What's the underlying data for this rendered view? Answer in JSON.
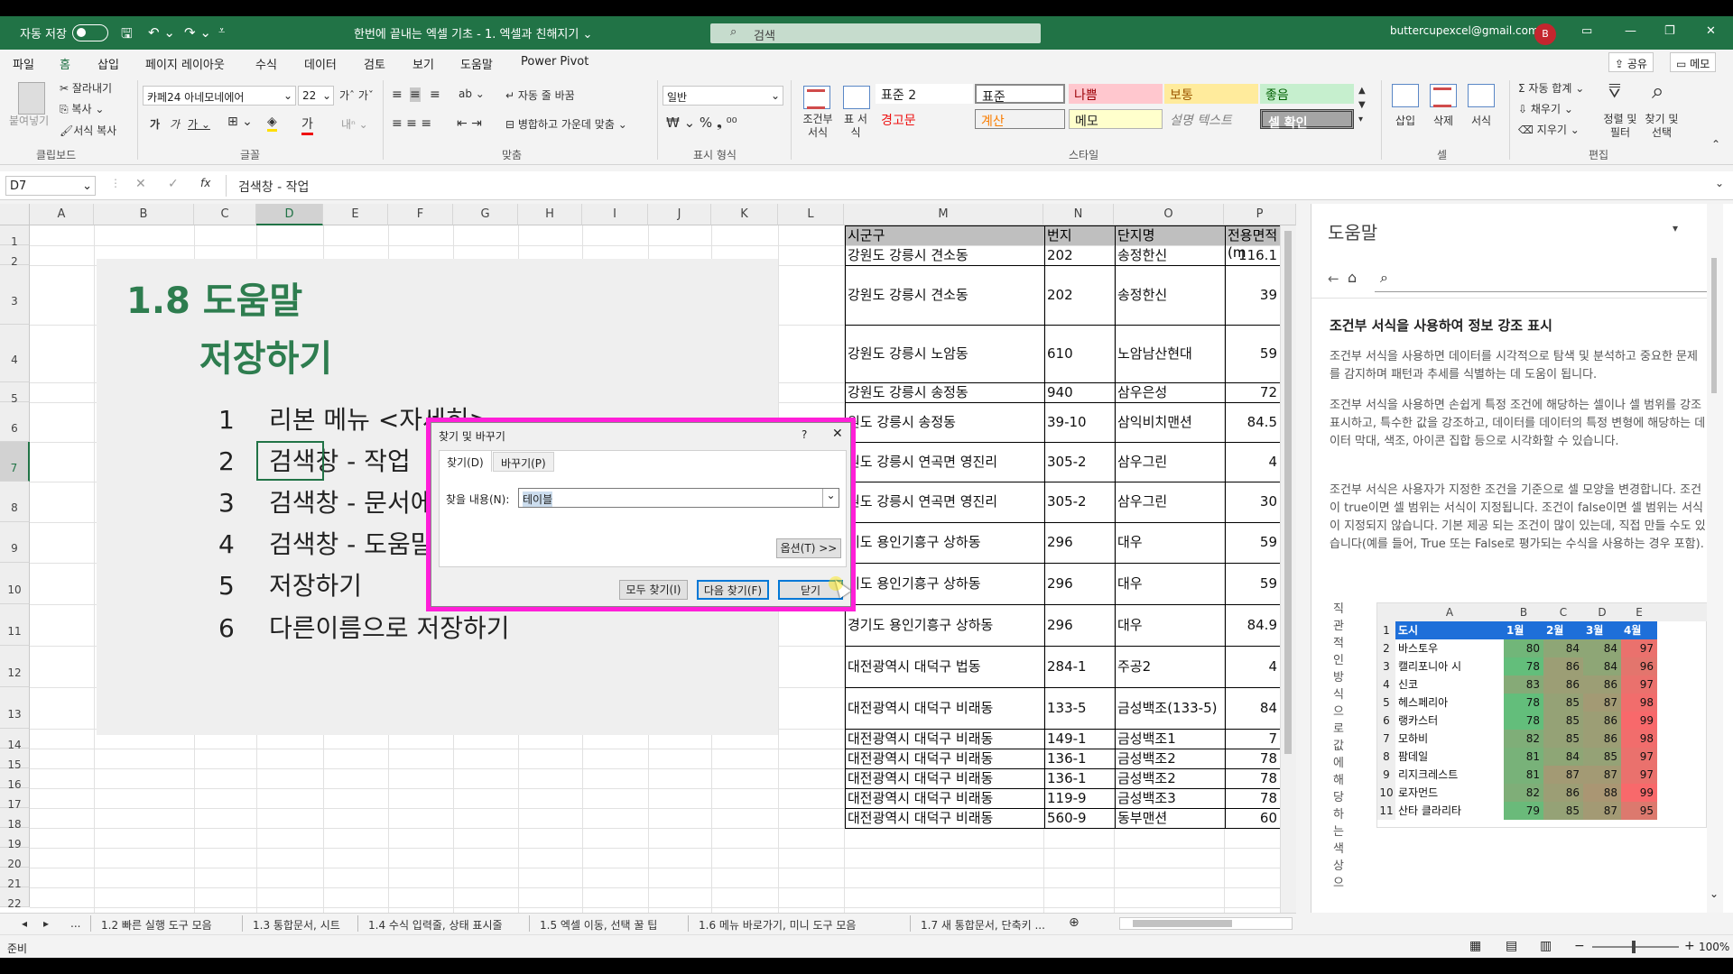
{
  "titlebar": {
    "autosave": "자동 저장",
    "doc_title": "한번에 끝내는 엑셀 기초 - 1. 엑셀과 친해지기 ⌄",
    "search_placeholder": "검색",
    "account": "buttercupexcel@gmail.com",
    "avatar": "B"
  },
  "menu": {
    "items": [
      "파일",
      "홈",
      "삽입",
      "페이지 레이아웃",
      "수식",
      "데이터",
      "검토",
      "보기",
      "도움말",
      "Power Pivot"
    ],
    "share": "공유",
    "memo": "메모"
  },
  "ribbon": {
    "clipboard": {
      "paste": "붙여넣기",
      "cut": "잘라내기",
      "copy": "복사",
      "format_painter": "서식 복사",
      "group": "클립보드"
    },
    "font": {
      "name": "카페24 아네모네에어",
      "size": "22",
      "group": "글꼴"
    },
    "align": {
      "wrap": "자동 줄 바꿈",
      "merge": "병합하고 가운데 맞춤",
      "group": "맞춤"
    },
    "number": {
      "format": "일반",
      "group": "표시 형식"
    },
    "styles": {
      "cond_format": "조건부 서식",
      "table_format": "표 서식",
      "cells": [
        "표준 2",
        "표준",
        "나쁨",
        "보통",
        "좋음",
        "경고문",
        "계산",
        "메모",
        "설명 텍스트",
        "셀 확인"
      ],
      "group": "스타일"
    },
    "cells_group": {
      "insert": "삽입",
      "delete": "삭제",
      "format": "서식",
      "group": "셀"
    },
    "edit": {
      "autosum": "자동 합계",
      "fill": "채우기",
      "clear": "지우기",
      "sort": "정렬 및 필터",
      "find": "찾기 및 선택",
      "group": "편집"
    }
  },
  "formula": {
    "namebox": "D7",
    "fx": "fx",
    "content": "검색창 - 작업"
  },
  "sheet": {
    "columns": [
      "A",
      "B",
      "C",
      "D",
      "E",
      "F",
      "G",
      "H",
      "I",
      "J",
      "K",
      "L",
      "M",
      "N",
      "O",
      "P"
    ],
    "rows": [
      "1",
      "2",
      "3",
      "4",
      "5",
      "6",
      "7",
      "8",
      "9",
      "10",
      "11",
      "12",
      "13",
      "14",
      "15",
      "16",
      "17",
      "18",
      "19",
      "20",
      "21",
      "22"
    ],
    "title1": "1.8 도움말",
    "title2": "저장하기",
    "items": [
      {
        "n": "1",
        "t": "리본 메뉴 <자세히>"
      },
      {
        "n": "2",
        "t": "검색창 - 작업"
      },
      {
        "n": "3",
        "t": "검색창 - 문서에서"
      },
      {
        "n": "4",
        "t": "검색창 - 도움말"
      },
      {
        "n": "5",
        "t": "저장하기"
      },
      {
        "n": "6",
        "t": "다른이름으로 저장하기"
      }
    ],
    "table_headers": [
      "시군구",
      "번지",
      "단지명",
      "전용면적(m"
    ],
    "table_rows": [
      [
        "강원도 강릉시 견소동",
        "202",
        "송정한신",
        "116.1"
      ],
      [
        "강원도 강릉시 견소동",
        "202",
        "송정한신",
        "39"
      ],
      [
        "강원도 강릉시 노암동",
        "610",
        "노암남산현대",
        "59"
      ],
      [
        "강원도 강릉시 송정동",
        "940",
        "삼우은성",
        "72"
      ],
      [
        "원도 강릉시 송정동",
        "39-10",
        "삼익비치맨션",
        "84.5"
      ],
      [
        "원도 강릉시 연곡면 영진리",
        "305-2",
        "삼우그린",
        "4"
      ],
      [
        "원도 강릉시 연곡면 영진리",
        "305-2",
        "삼우그린",
        "30"
      ],
      [
        "기도 용인기흥구 상하동",
        "296",
        "대우",
        "59"
      ],
      [
        "기도 용인기흥구 상하동",
        "296",
        "대우",
        "59"
      ],
      [
        "경기도 용인기흥구 상하동",
        "296",
        "대우",
        "84.9"
      ],
      [
        "대전광역시 대덕구 법동",
        "284-1",
        "주공2",
        "4"
      ],
      [
        "대전광역시 대덕구 비래동",
        "133-5",
        "금성백조(133-5)",
        "84"
      ],
      [
        "대전광역시 대덕구 비래동",
        "149-1",
        "금성백조1",
        "7"
      ],
      [
        "대전광역시 대덕구 비래동",
        "136-1",
        "금성백조2",
        "78"
      ],
      [
        "대전광역시 대덕구 비래동",
        "136-1",
        "금성백조2",
        "78"
      ],
      [
        "대전광역시 대덕구 비래동",
        "119-9",
        "금성백조3",
        "78"
      ],
      [
        "대전광역시 대덕구 비래동",
        "560-9",
        "동부맨션",
        "60"
      ]
    ]
  },
  "dialog": {
    "title": "찾기 및 바꾸기",
    "help": "?",
    "close": "✕",
    "tab_find": "찾기(D)",
    "tab_replace": "바꾸기(P)",
    "find_label": "찾을 내용(N):",
    "find_value": "테이블",
    "options": "옵션(T) >>",
    "find_all": "모두 찾기(I)",
    "find_next": "다음 찾기(F)",
    "close_btn": "닫기"
  },
  "help": {
    "title": "도움말",
    "heading": "조건부 서식을 사용하여 정보 강조 표시",
    "p1": "조건부 서식을 사용하면 데이터를 시각적으로 탐색 및 분석하고 중요한 문제를 감지하며 패턴과 추세를 식별하는 데 도움이 됩니다.",
    "p2": "조건부 서식을 사용하면 손쉽게 특정 조건에 해당하는 셀이나 셀 범위를 강조 표시하고, 특수한 값을 강조하고, 데이터를 데이터의 특정 변형에 해당하는 데이터 막대, 색조, 아이콘 집합 등으로 시각화할 수 있습니다.",
    "p3": "조건부 서식은 사용자가 지정한 조건을 기준으로 셀 모양을 변경합니다. 조건이 true이면 셀 범위는 서식이 지정됩니다. 조건이 false이면 셀 범위는 서식이 지정되지 않습니다. 기본 제공 되는 조건이 많이 있는데, 직접 만들 수도 있습니다(예를 들어, True 또는 False로 평가되는 수식을 사용하는 경우 포함).",
    "vertical": "직관적인방식으로값에해당하는색상으",
    "mini_cols": [
      "A",
      "B",
      "C",
      "D",
      "E"
    ],
    "mini_headers": [
      "도시",
      "1월",
      "2월",
      "3월",
      "4월"
    ],
    "mini_rows": [
      [
        "바스토우",
        "80",
        "84",
        "84",
        "97"
      ],
      [
        "캘리포니아 시",
        "78",
        "86",
        "84",
        "96"
      ],
      [
        "신코",
        "83",
        "86",
        "86",
        "97"
      ],
      [
        "헤스페리아",
        "78",
        "85",
        "87",
        "98"
      ],
      [
        "랭카스터",
        "78",
        "85",
        "86",
        "99"
      ],
      [
        "모하비",
        "82",
        "85",
        "86",
        "98"
      ],
      [
        "팜데일",
        "81",
        "84",
        "85",
        "97"
      ],
      [
        "리지크레스트",
        "81",
        "87",
        "87",
        "97"
      ],
      [
        "로자먼드",
        "82",
        "86",
        "88",
        "99"
      ],
      [
        "산타 클라리타",
        "79",
        "85",
        "87",
        "95"
      ]
    ]
  },
  "tabs": [
    "1.2 빠른 실행 도구 모음",
    "1.3 통합문서, 시트",
    "1.4 수식 입력줄, 상태 표시줄",
    "1.5 엑셀 이동, 선택 꿀 팁",
    "1.6 메뉴 바로가기, 미니 도구 모음",
    "1.7 새 통합문서, 단축키 ..."
  ],
  "tabs_more": "...",
  "status": {
    "ready": "준비",
    "zoom": "100%"
  }
}
